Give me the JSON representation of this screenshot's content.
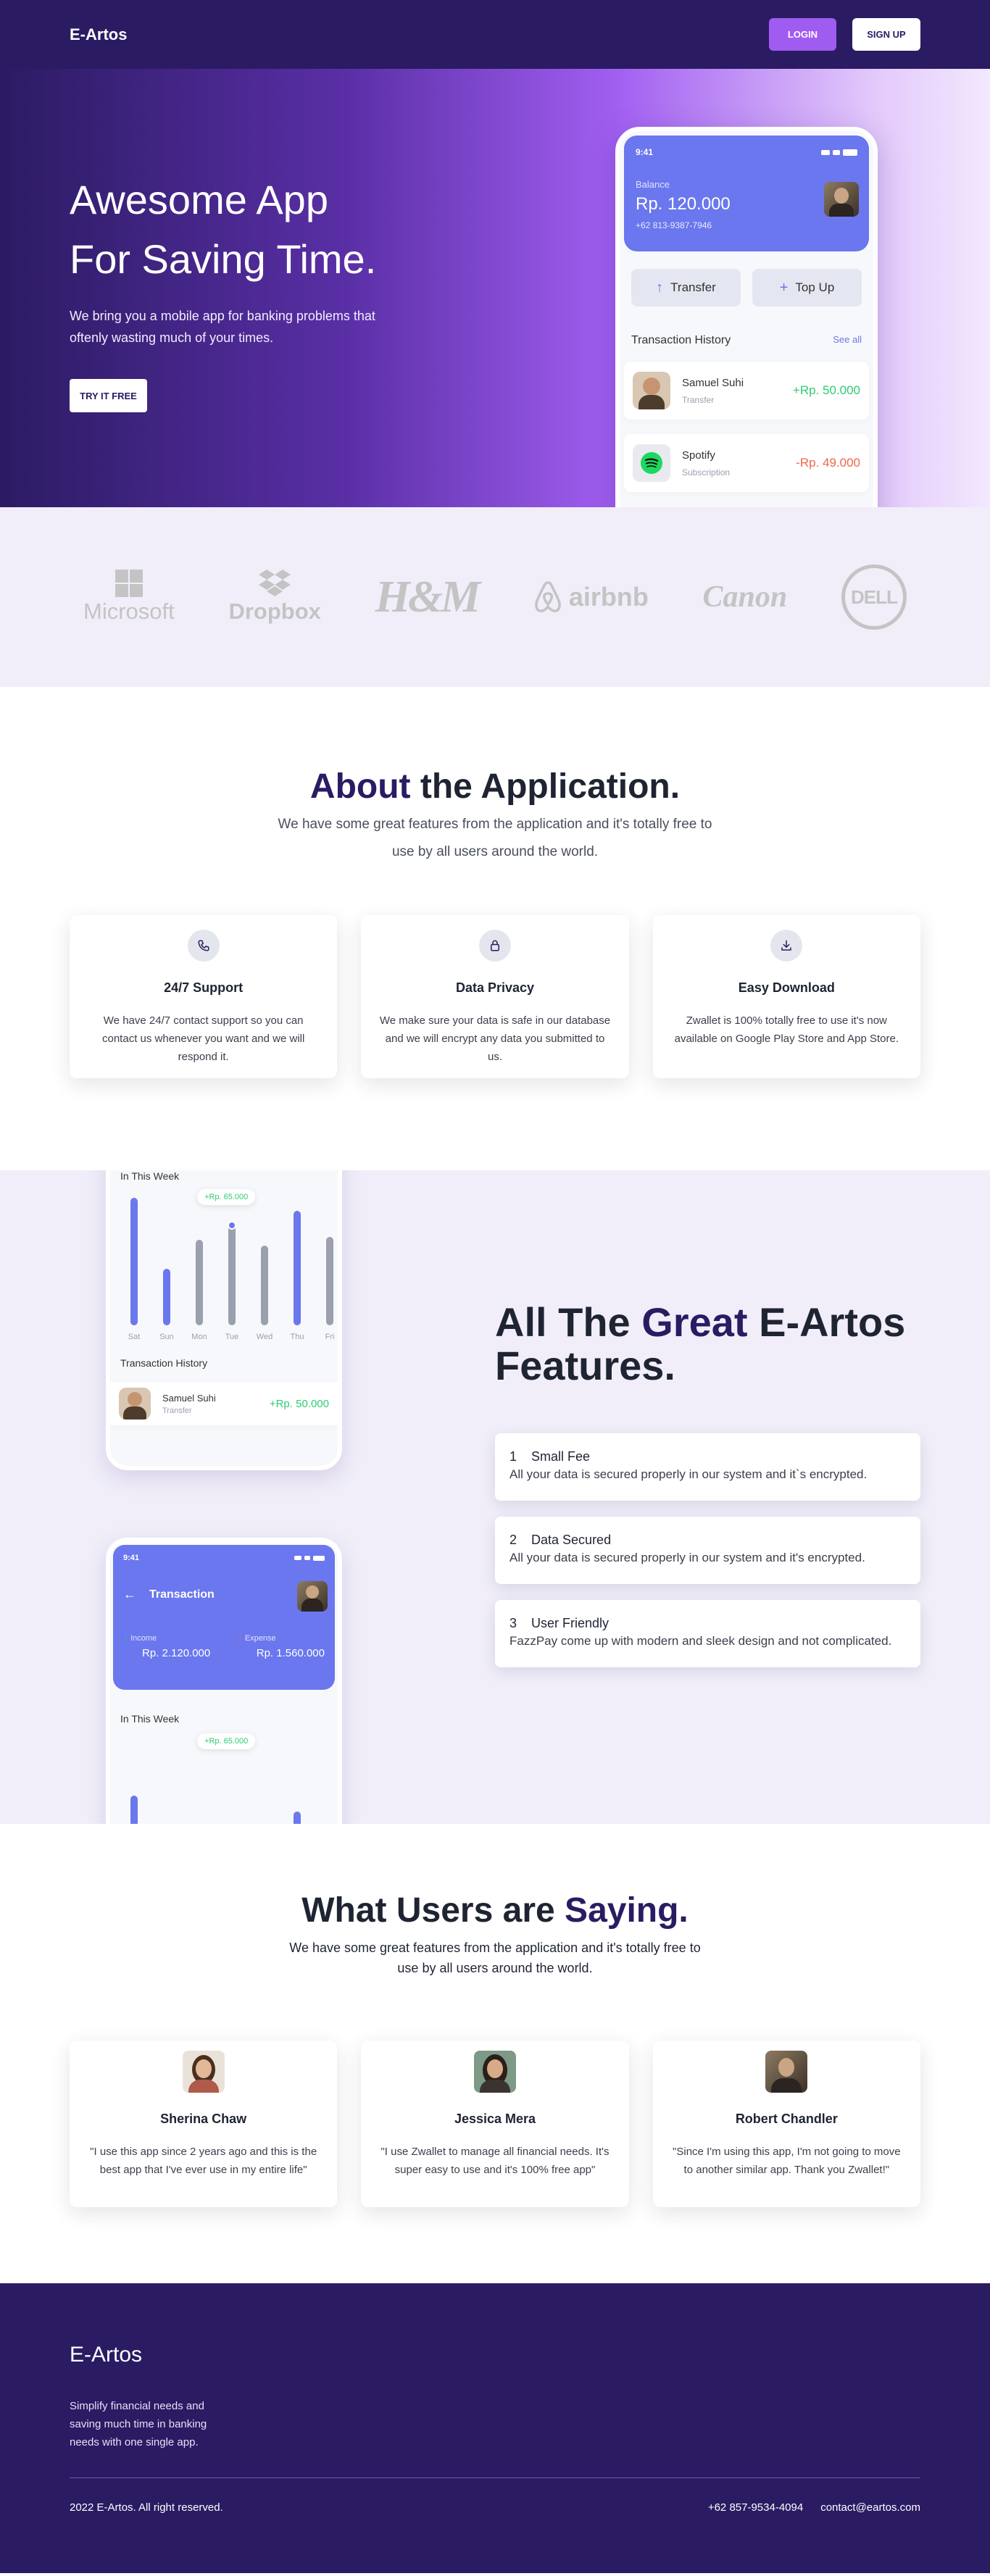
{
  "nav": {
    "brand": "E-Artos",
    "login": "LOGIN",
    "signup": "SIGN UP"
  },
  "hero": {
    "title_line1": "Awesome App",
    "title_line2": "For Saving Time.",
    "subtitle": "We bring you a mobile app for banking problems that oftenly wasting much of your times.",
    "cta": "TRY IT FREE",
    "phone": {
      "time": "9:41",
      "balance_label": "Balance",
      "balance": "Rp. 120.000",
      "account": "+62 813-9387-7946",
      "transfer": "Transfer",
      "topup": "Top Up",
      "history_title": "Transaction History",
      "see_all": "See all",
      "transactions": [
        {
          "name": "Samuel Suhi",
          "type": "Transfer",
          "amount": "+Rp. 50.000"
        },
        {
          "name": "Spotify",
          "type": "Subscription",
          "amount": "-Rp. 49.000"
        }
      ]
    }
  },
  "logos": [
    "Microsoft",
    "Dropbox",
    "H&M",
    "airbnb",
    "Canon",
    "DELL"
  ],
  "about": {
    "title_hl": "About",
    "title_rest": " the Application.",
    "subtitle": "We have some great features from the application and it's totally free to use by all users around the world.",
    "cards": [
      {
        "icon": "phone-icon",
        "title": "24/7 Support",
        "text": "We have 24/7 contact support so you can contact us whenever you want and we will respond it."
      },
      {
        "icon": "lock-icon",
        "title": "Data Privacy",
        "text": "We make sure your data is safe in our database and we will encrypt any data you submitted to us."
      },
      {
        "icon": "download-icon",
        "title": "Easy Download",
        "text": "Zwallet is 100% totally free to use it's now available on Google Play Store and App Store."
      }
    ]
  },
  "features": {
    "title_a": "All The ",
    "title_hl": "Great",
    "title_b": " E-Artos",
    "title_c": "Features.",
    "items": [
      {
        "num": "1",
        "title": "Small Fee",
        "desc": "All your data is secured properly in our system and it`s encrypted."
      },
      {
        "num": "2",
        "title": "Data Secured",
        "desc": "All your data is secured properly in our system and it's encrypted."
      },
      {
        "num": "3",
        "title": "User Friendly",
        "desc": "FazzPay come up with modern and sleek design and not complicated."
      }
    ],
    "phone_top": {
      "chart_title": "In This Week",
      "tooltip": "+Rp. 65.000",
      "days": [
        "Sat",
        "Sun",
        "Mon",
        "Tue",
        "Wed",
        "Thu",
        "Fri"
      ],
      "history_title": "Transaction History",
      "tx_name": "Samuel Suhi",
      "tx_type": "Transfer",
      "tx_amount": "+Rp. 50.000"
    },
    "phone_bottom": {
      "time": "9:41",
      "title": "Transaction",
      "income_label": "Income",
      "income": "Rp. 2.120.000",
      "expense_label": "Expense",
      "expense": "Rp. 1.560.000",
      "chart_title": "In This Week",
      "tooltip": "+Rp. 65.000"
    }
  },
  "testimonials": {
    "title_a": "What Users are ",
    "title_hl": "Saying.",
    "subtitle": "We have some great features from the application and it's totally free to use by all users around the world.",
    "items": [
      {
        "name": "Sherina Chaw",
        "quote": "\"I use this app since 2 years ago and this is the best app that I've ever use in my entire life\""
      },
      {
        "name": "Jessica Mera",
        "quote": "\"I use Zwallet to manage all financial needs. It's super easy to use and it's 100% free app\""
      },
      {
        "name": "Robert Chandler",
        "quote": "\"Since I'm using this app, I'm not going to move to another similar app. Thank you Zwallet!\""
      }
    ]
  },
  "footer": {
    "brand": "E-Artos",
    "desc": "Simplify financial needs and saving much time in banking needs with one single app.",
    "copyright": "2022 E-Artos. All right reserved.",
    "phone": "+62 857-9534-4094",
    "email": "contact@eartos.com"
  }
}
